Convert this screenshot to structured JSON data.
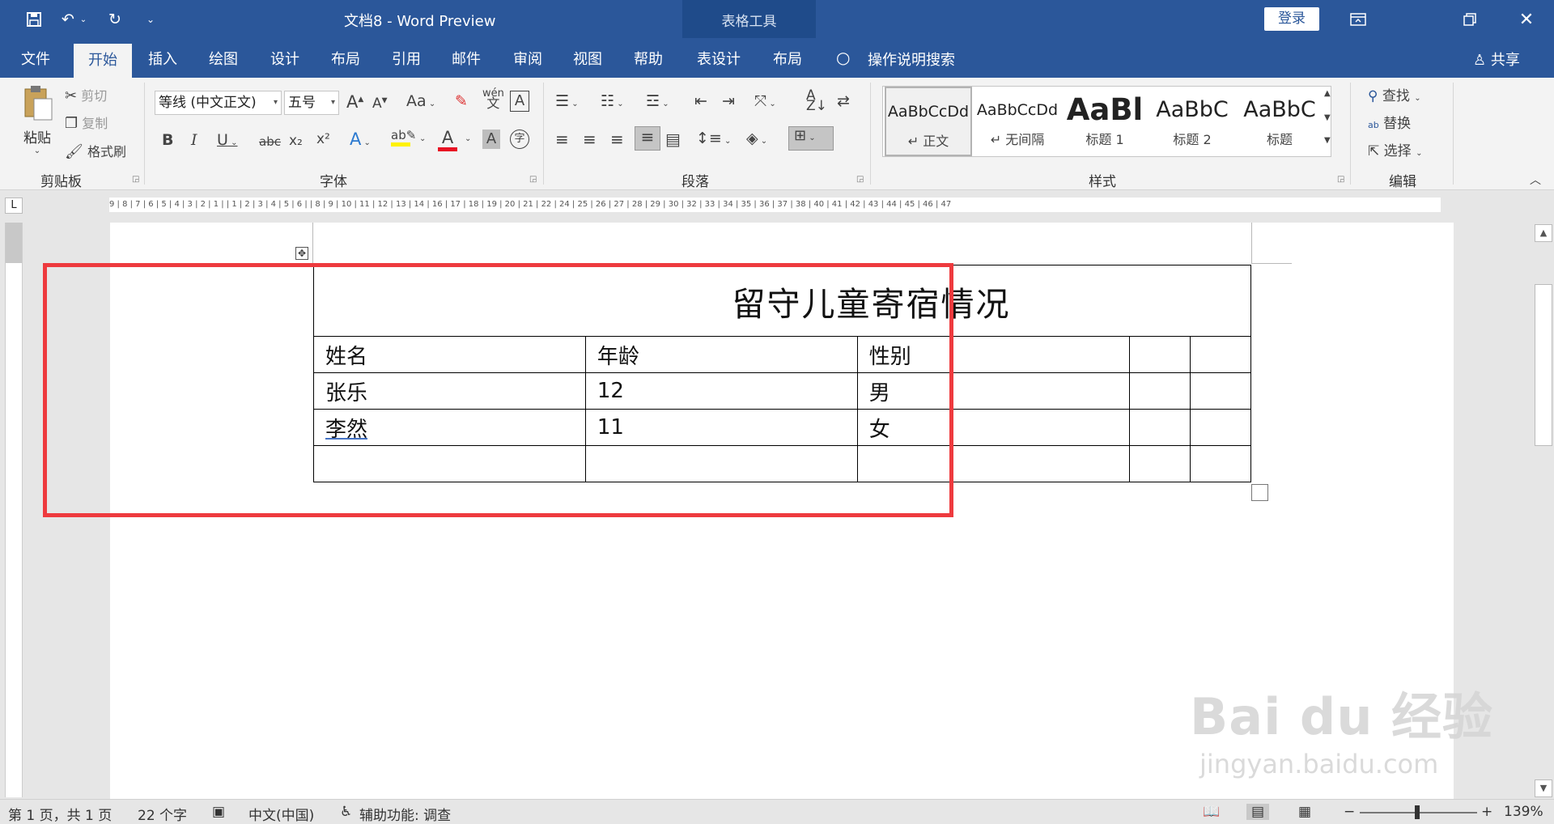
{
  "titlebar": {
    "doc_title": "文档8  -  Word Preview",
    "context_tab": "表格工具",
    "login_label": "登录",
    "icons": [
      "save-icon",
      "undo-icon",
      "redo-icon",
      "customize-qat-icon",
      "ribbon-display-icon",
      "restore-icon",
      "close-icon"
    ]
  },
  "tabs": {
    "file": "文件",
    "home": "开始",
    "insert": "插入",
    "draw": "绘图",
    "design": "设计",
    "layout": "布局",
    "references": "引用",
    "mailings": "邮件",
    "review": "审阅",
    "view": "视图",
    "help": "帮助",
    "table_design": "表设计",
    "table_layout": "布局",
    "tell_me": "操作说明搜索",
    "share": "共享"
  },
  "clipboard": {
    "paste": "粘贴",
    "cut": "剪切",
    "copy": "复制",
    "format_painter": "格式刷",
    "group_label": "剪贴板"
  },
  "font": {
    "font_name": "等线 (中文正文)",
    "font_size": "五号",
    "grow": "A",
    "shrink": "A",
    "change_case": "Aa",
    "bold": "B",
    "italic": "I",
    "underline": "U",
    "strike": "abc",
    "subscript": "x₂",
    "superscript": "x²",
    "group_label": "字体"
  },
  "paragraph": {
    "group_label": "段落"
  },
  "styles": {
    "items": [
      {
        "sample": "AaBbCcDd",
        "label": "↵ 正文"
      },
      {
        "sample": "AaBbCcDd",
        "label": "↵ 无间隔"
      },
      {
        "sample": "AaBl",
        "label": "标题 1"
      },
      {
        "sample": "AaBbC",
        "label": "标题 2"
      },
      {
        "sample": "AaBbC",
        "label": "标题"
      }
    ],
    "group_label": "样式"
  },
  "editing": {
    "find": "查找",
    "replace": "替换",
    "select": "选择",
    "group_label": "编辑"
  },
  "ruler": {
    "ticks": "9 | 8 | 7 | 6 | 5 | 4 | 3 | 2 | 1 |      | 1 | 2 | 3 | 4 | 5 | 6 |      | 8 | 9 | 10 | 11 | 12 | 13 | 14 |    16 | 17 | 18 | 19 | 20 | 21 | 22 |    24 | 25 | 26 | 27 | 28 | 29 | 30 |    32 | 33 | 34 | 35 | 36 | 37 | 38 |    40 | 41 | 42 | 43 | 44 | 45 | 46 | 47"
  },
  "table": {
    "title": "留守儿童寄宿情况",
    "header": [
      "姓名",
      "年龄",
      "性别",
      "",
      ""
    ],
    "rows": [
      [
        "张乐",
        "12",
        "男",
        "",
        ""
      ],
      [
        "李然",
        "11",
        "女",
        "",
        ""
      ],
      [
        "",
        "",
        "",
        "",
        ""
      ]
    ]
  },
  "statusbar": {
    "page": "第 1 页，共 1 页",
    "words": "22 个字",
    "language": "中文(中国)",
    "accessibility": "辅助功能: 调查",
    "zoom_minus": "−",
    "zoom_plus": "+",
    "zoom": "139%",
    "zoom_level": 0.49
  },
  "watermark": {
    "big": "Bai du 经验",
    "small": "jingyan.baidu.com"
  },
  "colors": {
    "brand": "#2b579a",
    "highlight_box": "#ee3a3e",
    "font_color": "#e81123",
    "highlight_color": "#fff200"
  }
}
